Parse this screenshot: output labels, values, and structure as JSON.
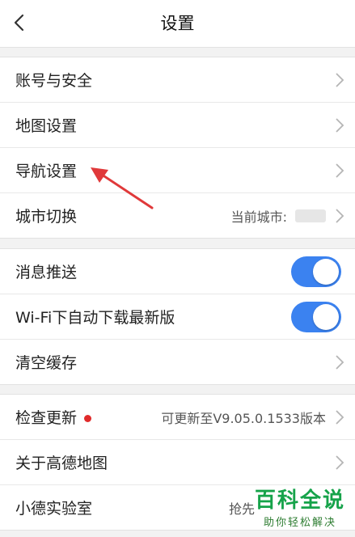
{
  "header": {
    "title": "设置"
  },
  "group1": [
    {
      "label": "账号与安全"
    },
    {
      "label": "地图设置"
    },
    {
      "label": "导航设置"
    },
    {
      "label": "城市切换",
      "value": "当前城市:"
    }
  ],
  "group2": [
    {
      "label": "消息推送",
      "toggle": true
    },
    {
      "label": "Wi-Fi下自动下载最新版",
      "toggle": true
    },
    {
      "label": "清空缓存"
    }
  ],
  "group3": [
    {
      "label": "检查更新",
      "value": "可更新至V9.05.0.1533版本"
    },
    {
      "label": "关于高德地图"
    },
    {
      "label": "小德实验室",
      "value": "抢先"
    }
  ],
  "watermark": {
    "title": "百科全说",
    "subtitle": "助你轻松解决"
  },
  "colors": {
    "toggle_on": "#3b82f0",
    "badge": "#e02b2b",
    "annotation": "#e0393a",
    "watermark": "#16a34a"
  }
}
